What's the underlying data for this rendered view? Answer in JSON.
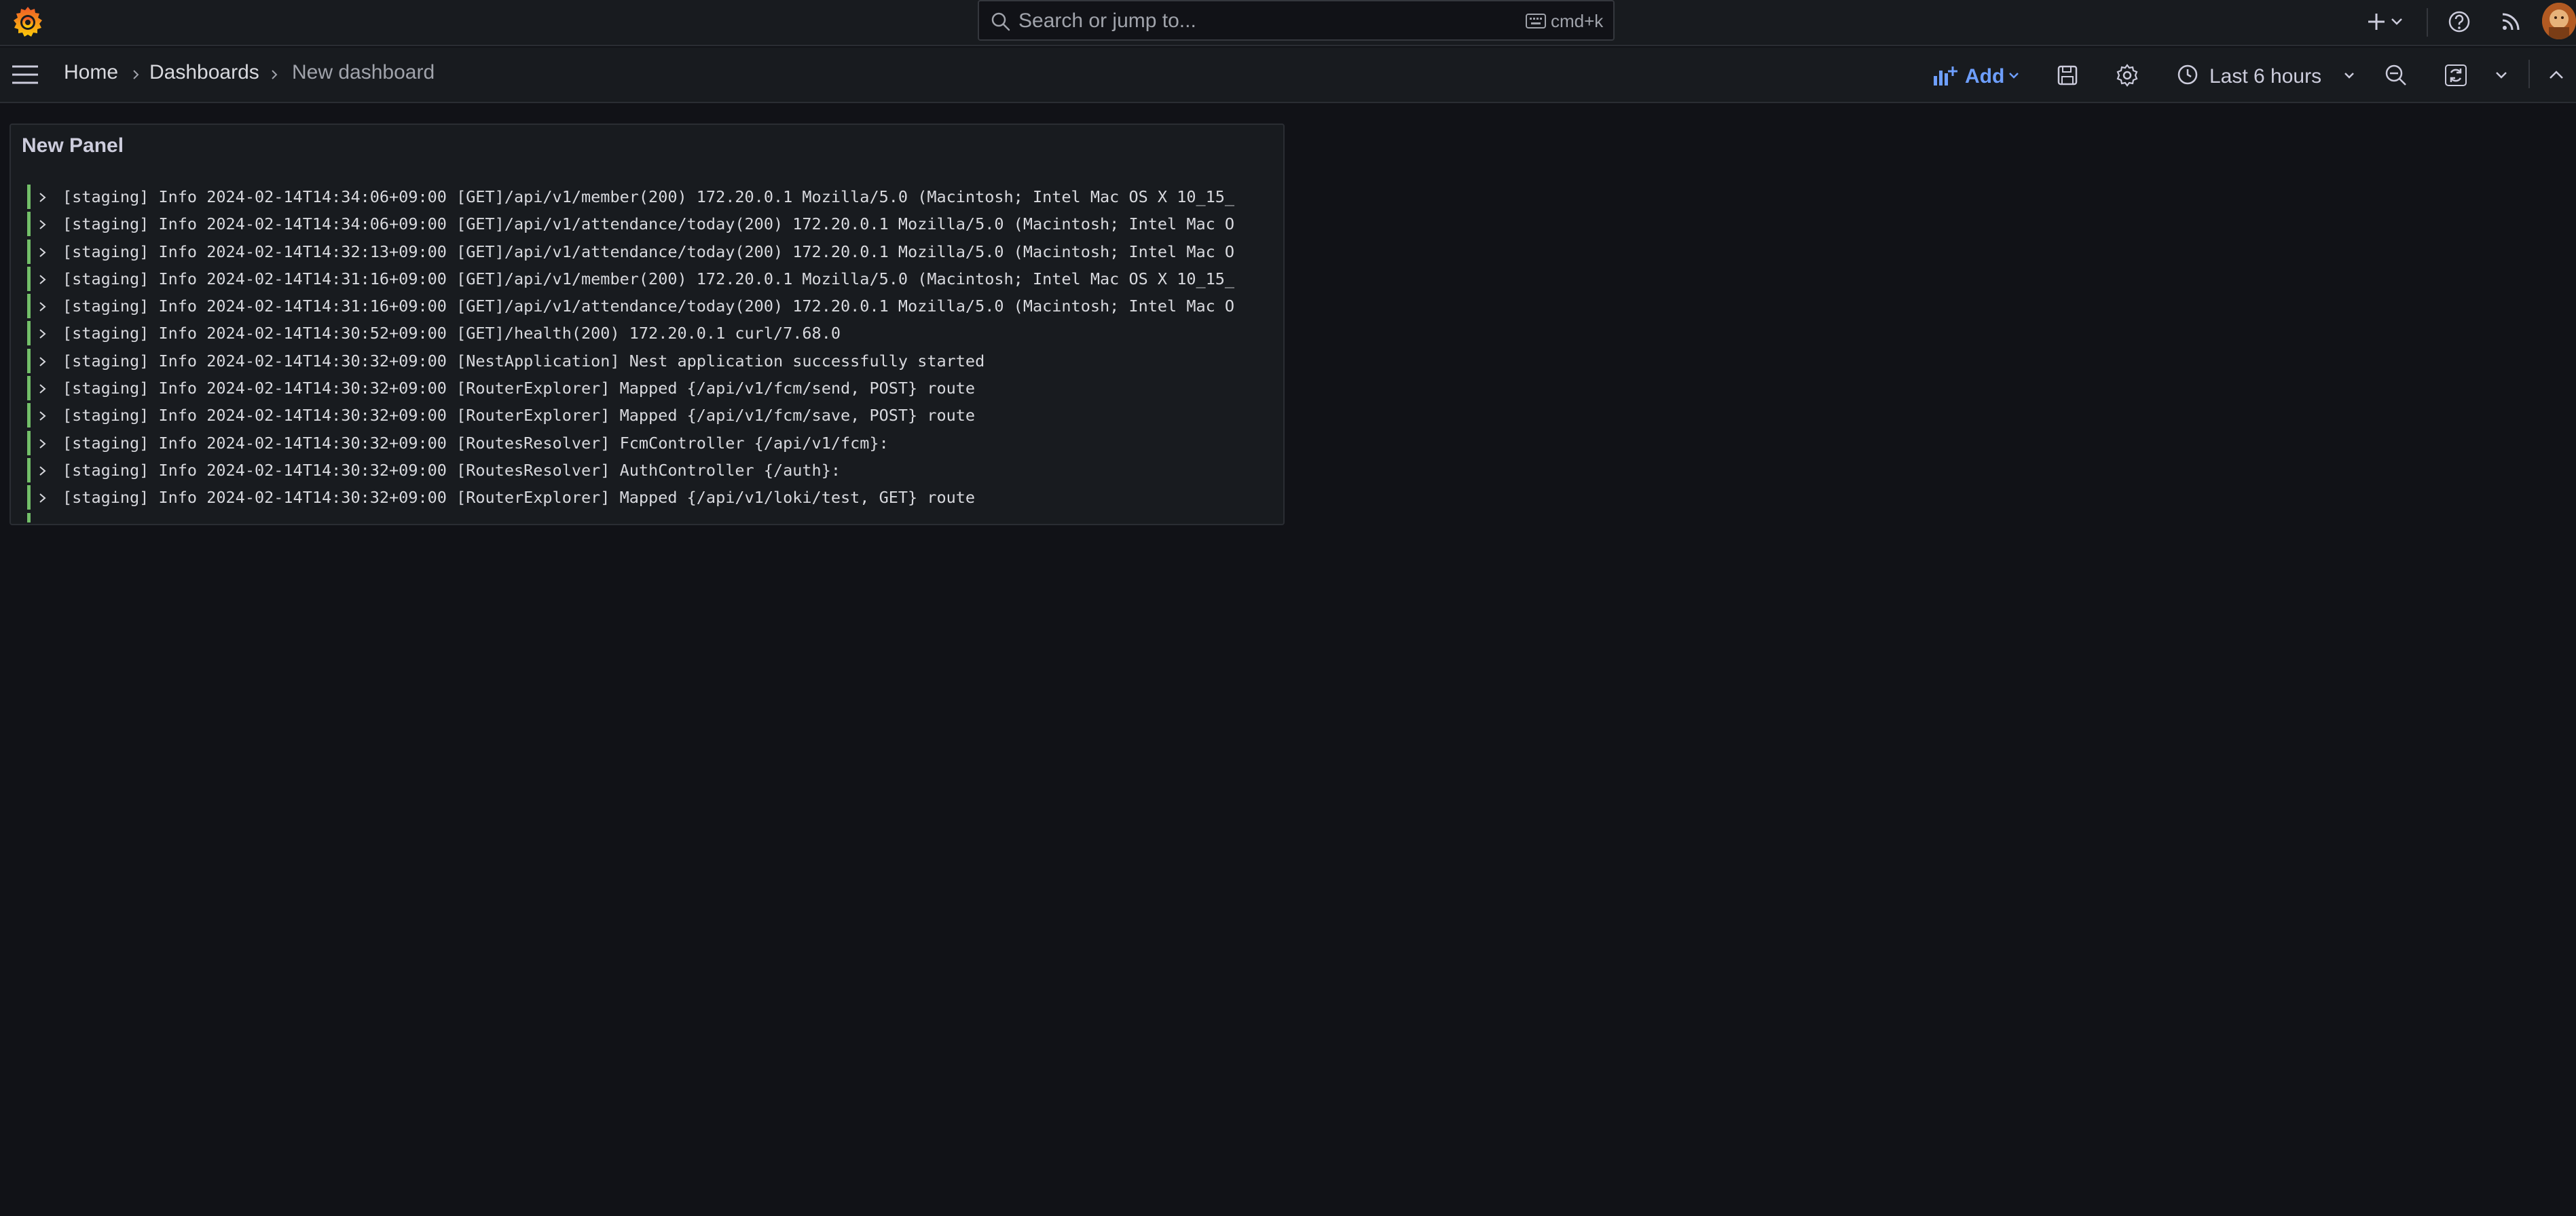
{
  "topbar": {
    "search_placeholder": "Search or jump to...",
    "search_shortcut": "cmd+k",
    "icons": [
      "grafana-logo-icon",
      "search-icon",
      "keyboard-icon",
      "plus-icon",
      "chevron-down-icon",
      "help-icon",
      "news-feed-icon",
      "user-avatar"
    ]
  },
  "breadcrumb": {
    "items": [
      "Home",
      "Dashboards",
      "New dashboard"
    ]
  },
  "toolbar": {
    "add_label": "Add",
    "time_range_label": "Last 6 hours"
  },
  "panel": {
    "title": "New Panel",
    "logs": [
      "[staging] Info  2024-02-14T14:34:06+09:00 [GET]/api/v1/member(200) 172.20.0.1 Mozilla/5.0 (Macintosh; Intel Mac OS X 10_15_",
      "[staging] Info  2024-02-14T14:34:06+09:00 [GET]/api/v1/attendance/today(200) 172.20.0.1 Mozilla/5.0 (Macintosh; Intel Mac O",
      "[staging] Info  2024-02-14T14:32:13+09:00 [GET]/api/v1/attendance/today(200) 172.20.0.1 Mozilla/5.0 (Macintosh; Intel Mac O",
      "[staging] Info  2024-02-14T14:31:16+09:00 [GET]/api/v1/member(200) 172.20.0.1 Mozilla/5.0 (Macintosh; Intel Mac OS X 10_15_",
      "[staging] Info  2024-02-14T14:31:16+09:00 [GET]/api/v1/attendance/today(200) 172.20.0.1 Mozilla/5.0 (Macintosh; Intel Mac O",
      "[staging] Info  2024-02-14T14:30:52+09:00 [GET]/health(200) 172.20.0.1 curl/7.68.0",
      "[staging] Info  2024-02-14T14:30:32+09:00 [NestApplication] Nest application successfully started",
      "[staging] Info  2024-02-14T14:30:32+09:00 [RouterExplorer] Mapped {/api/v1/fcm/send, POST} route",
      "[staging] Info  2024-02-14T14:30:32+09:00 [RouterExplorer] Mapped {/api/v1/fcm/save, POST} route",
      "[staging] Info  2024-02-14T14:30:32+09:00 [RoutesResolver] FcmController {/api/v1/fcm}:",
      "[staging] Info  2024-02-14T14:30:32+09:00 [RoutesResolver] AuthController {/auth}:",
      "[staging] Info  2024-02-14T14:30:32+09:00 [RouterExplorer] Mapped {/api/v1/loki/test, GET} route"
    ]
  },
  "colors": {
    "accent": "#6e9fff",
    "log_info": "#73bf69",
    "background": "#111217",
    "surface": "#181b1f"
  }
}
